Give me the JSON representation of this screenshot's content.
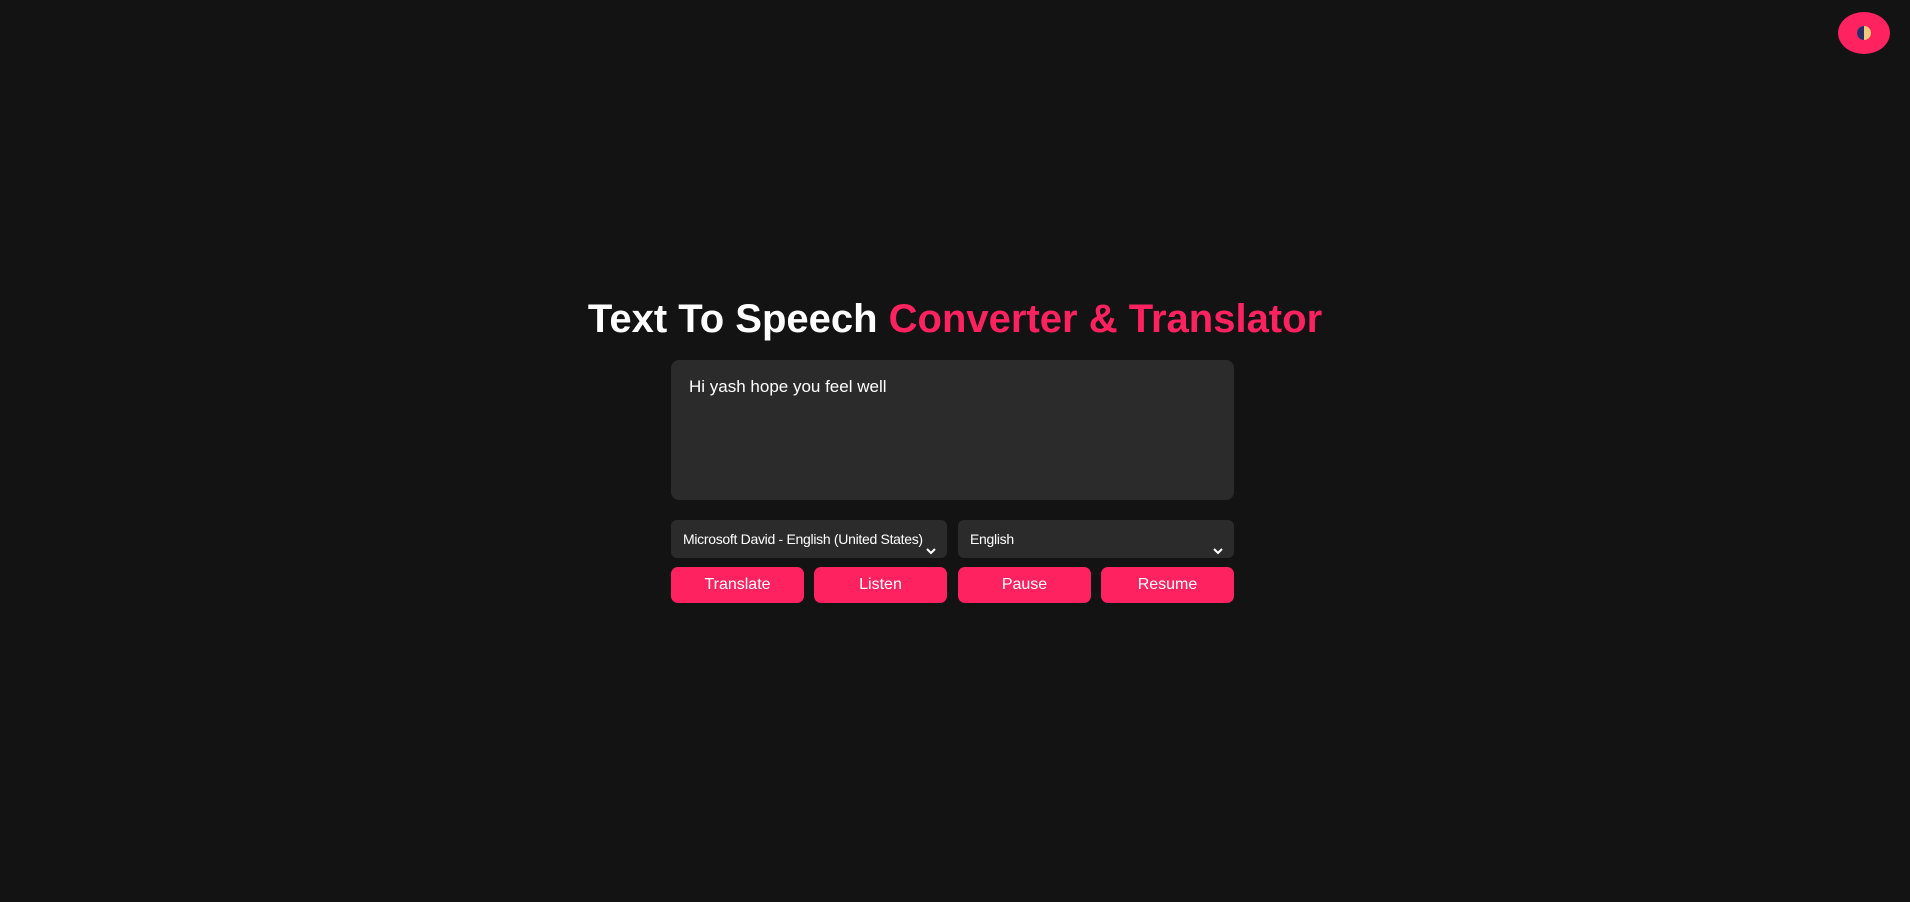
{
  "header": {
    "theme_toggle_icon": "contrast-icon"
  },
  "title": {
    "part1": "Text To Speech",
    "part2": "Converter & Translator"
  },
  "editor": {
    "text": "Hi yash hope you feel well"
  },
  "voice_select": {
    "selected": "Microsoft David - English (United States)"
  },
  "language_select": {
    "selected": "English"
  },
  "buttons": {
    "translate": "Translate",
    "listen": "Listen",
    "pause": "Pause",
    "resume": "Resume"
  },
  "colors": {
    "background": "#131313",
    "accent": "#fe2260",
    "panel": "#2b2b2b"
  }
}
